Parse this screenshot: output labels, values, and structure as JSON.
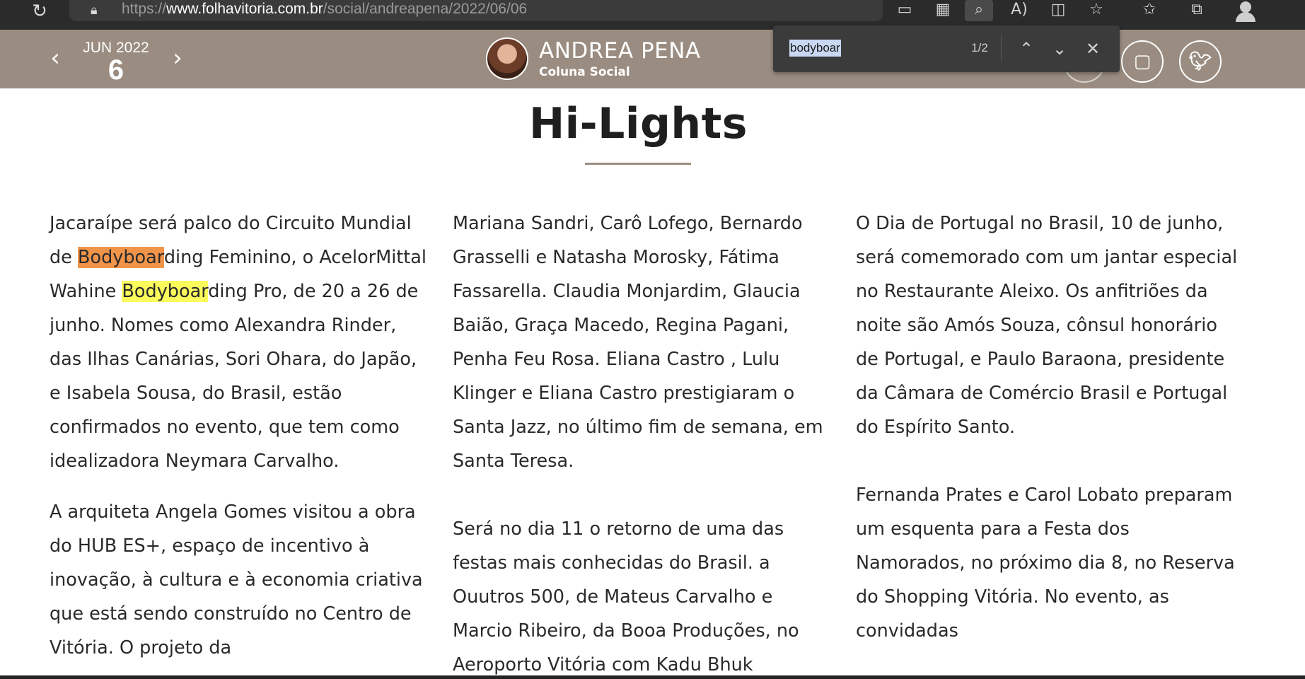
{
  "browser": {
    "url_prefix": "https://",
    "url_host": "www.folhavitoria.com.br",
    "url_path": "/social/andreapena/2022/06/06",
    "toolbar_icons": [
      "reload-icon",
      "lock-icon",
      "devices-icon",
      "apps-icon",
      "find-icon",
      "read-aloud-icon",
      "immersive-reader-icon",
      "add-favorite-icon",
      "favorites-icon",
      "collections-icon",
      "profile-icon"
    ]
  },
  "header": {
    "month_year": "JUN 2022",
    "day": "6",
    "prev_icon": "chevron-left-icon",
    "next_icon": "chevron-right-icon",
    "author_name": "ANDREA PENA",
    "author_subtitle": "Coluna Social",
    "social": [
      "instagram-icon",
      "twitter-icon"
    ]
  },
  "find": {
    "query": "bodyboar",
    "count": "1/2"
  },
  "page": {
    "title": "Hi-Lights",
    "columns": [
      {
        "p1": {
          "before": "Jacaraípe será palco do Circuito Mundial de ",
          "match1": "Bodyboar",
          "mid": "ding Feminino, o AcelorMittal Wahine ",
          "match2": "Bodyboar",
          "after": "ding Pro, de 20 a 26 de junho. Nomes como Alexandra Rinder, das Ilhas Canárias, Sori Ohara, do Japão, e Isabela Sousa, do Brasil, estão confirmados no evento, que tem como idealizadora Neymara Carvalho."
        },
        "p2": "A arquiteta Angela Gomes visitou a obra do HUB ES+, espaço de incentivo à inovação, à cultura e à economia criativa que está sendo construído no Centro de Vitória. O projeto da"
      },
      {
        "p1": "Mariana Sandri, Carô Lofego, Bernardo Grasselli e Natasha Morosky, Fátima Fassarella. Claudia Monjardim, Glaucia Baião, Graça Macedo, Regina Pagani, Penha Feu Rosa. Eliana Castro , Lulu Klinger e Eliana Castro prestigiaram o Santa Jazz, no último fim de semana, em Santa Teresa.",
        "p2": "Será no dia 11 o retorno de uma das festas mais conhecidas do Brasil. a Ouutros 500, de Mateus Carvalho e Marcio Ribeiro, da Booa Produções, no Aeroporto Vitória com Kadu Bhuk"
      },
      {
        "p1": "O Dia de Portugal no Brasil, 10 de junho, será comemorado com um jantar especial no Restaurante Aleixo. Os anfitriões da noite são Amós Souza, cônsul honorário de Portugal, e Paulo Baraona, presidente da Câmara de Comércio Brasil e Portugal do Espírito Santo.",
        "p2": "Fernanda Prates e Carol Lobato preparam um esquenta para a Festa dos Namorados, no próximo dia 8, no Reserva do Shopping Vitória. No evento, as convidadas"
      }
    ]
  }
}
